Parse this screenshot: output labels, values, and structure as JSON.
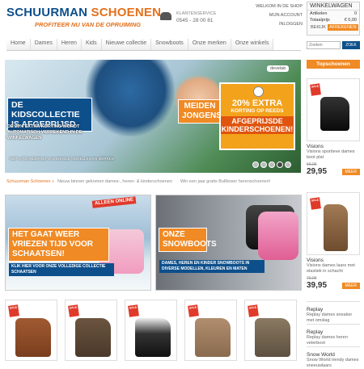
{
  "header": {
    "logo_text_1": "SCHUURMAN",
    "logo_text_2": "SCHOENEN",
    "slogan": "PROFITEER NU VAN DE OPRUIMING",
    "service_label": "KLANTENSERVICE",
    "service_phone": "0545 - 28 00 81",
    "top_links": [
      "WELKOM IN DE SHOP",
      "MIJN ACCOUNT",
      "INLOGGEN"
    ]
  },
  "cart": {
    "title": "WINKELWAGEN",
    "items_label": "Artikelen",
    "items_value": "0",
    "total_label": "Totaalprijs",
    "total_value": "€ 0,00",
    "view_label": "BEKIJK",
    "checkout_label": "AFREKENEN"
  },
  "nav": {
    "items": [
      "Home",
      "Dames",
      "Heren",
      "Kids",
      "Nieuwe collectie",
      "Snowboots",
      "Onze merken",
      "Onze winkels"
    ]
  },
  "search": {
    "placeholder": "Zoeken",
    "button": "ZOEK"
  },
  "hero": {
    "headline": "DE KIDSCOLLECTIE IS AFGEPRIJSD",
    "subline": "DE 20% EXTRA KORTING WORDT AUTOMATISCH VERREKEND IN DE WINKELWAGEN",
    "footnote": "*MET UITZONDERING VAN ENKELE MODELLEN EN MERKEN",
    "audience": "MEIDEN JONGENS",
    "promo_1": "20% EXTRA",
    "promo_2": "KORTING OP REEDS",
    "promo_3": "AFGEPRIJSDE KINDERSCHOENEN!",
    "brand": "develab"
  },
  "breadcrumb": {
    "home": "Schuurman Schoenen »",
    "items": [
      "Nieuw binnen gekomen dames-, heren- & kinderschoenen",
      "Win een jaar gratis Bullboxer herenschoenen!"
    ]
  },
  "banners": {
    "left": {
      "tag": "ALLEEN ONLINE",
      "headline": "HET GAAT WEER VRIEZEN TIJD VOOR SCHAATSEN!",
      "sub": "KLIK HIER VOOR ONZE VOLLEDIGE COLLECTIE SCHAATSEN"
    },
    "right": {
      "headline": "ONZE SNOWBOOTS",
      "sub": "DAMES, HEREN EN KINDER SNOWBOOTS IN DIVERSE MODELLEN, KLEUREN EN MATEN"
    }
  },
  "sidebar": {
    "header": "Topschoenen",
    "card1": {
      "name": "Visions",
      "desc": "Visions sportieve dames boot plat",
      "old": "59,95",
      "price": "29,95",
      "more": "MEER"
    },
    "card2": {
      "name": "Visions",
      "desc": "Visions dames laars met elastiek in schacht",
      "old": "79,95",
      "price": "39,95",
      "more": "MEER"
    },
    "list": [
      {
        "name": "Replay",
        "desc": "Replay dames sneaker met omslag"
      },
      {
        "name": "Replay",
        "desc": "Replay dames heren veterboot"
      },
      {
        "name": "Snow World",
        "desc": "Snow World trendy dames sneeuwlaars"
      }
    ]
  },
  "product_sale_label": "SALE",
  "colors": {
    "brand_blue": "#0d4f8b",
    "brand_orange": "#f08a24"
  }
}
